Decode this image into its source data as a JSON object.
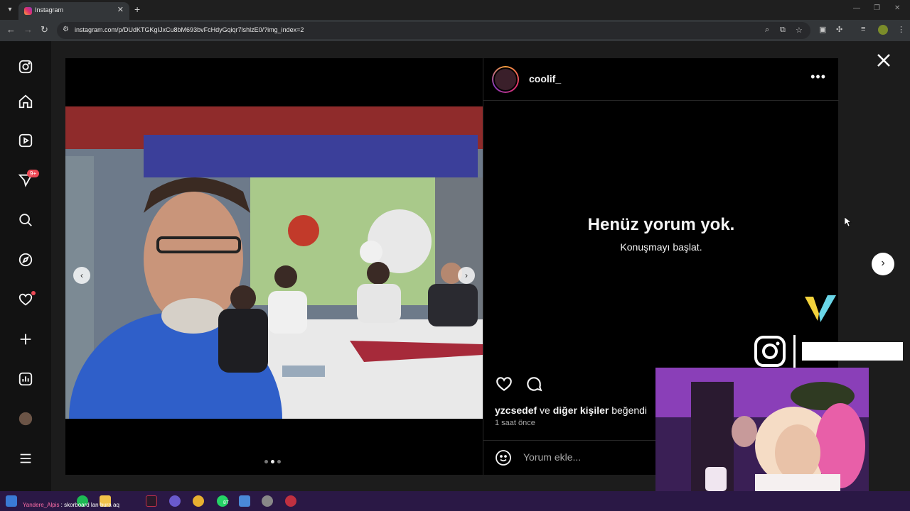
{
  "browser": {
    "tab_title": "Instagram",
    "url": "instagram.com/p/DUdKTGKgIJxCu8bM693bvFcHdyGqiqr7lshlzE0/?img_index=2"
  },
  "sidebar": {
    "notification_badge": "9+"
  },
  "post": {
    "username": "coolif_",
    "more_label": "•••",
    "empty_title": "Henüz yorum yok.",
    "empty_subtitle": "Konuşmayı başlat.",
    "liked_by_user": "yzcsedef",
    "liked_by_connector": " ve ",
    "liked_by_others": "diğer kişiler",
    "liked_by_suffix": " beğendi",
    "time_ago": "1 saat önce",
    "comment_placeholder": "Yorum ekle...",
    "carousel_index": 2,
    "carousel_count": 3
  },
  "chat_overlay": {
    "user": "Yandere_Alpis",
    "separator": " : ",
    "message": "skorboard lan bura aq"
  },
  "taskbar": {
    "whatsapp_badge": "87"
  },
  "colors": {
    "accent_badge": "#ed4956",
    "background": "#000000",
    "taskbar": "#2a1845"
  }
}
